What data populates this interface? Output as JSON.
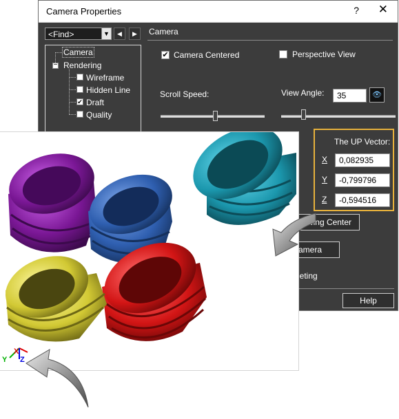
{
  "window": {
    "title": "Camera Properties",
    "help_glyph": "?",
    "close_glyph": "✕"
  },
  "find": {
    "value": "<Find>"
  },
  "tree": {
    "items": [
      {
        "label": "Camera"
      },
      {
        "label": "Rendering"
      },
      {
        "label": "Wireframe",
        "checked": false
      },
      {
        "label": "Hidden Line",
        "checked": false
      },
      {
        "label": "Draft",
        "checked": true
      },
      {
        "label": "Quality",
        "checked": false
      }
    ]
  },
  "camera": {
    "section_title": "Camera",
    "camera_centered": {
      "label": "Camera Centered",
      "checked": true
    },
    "perspective_view": {
      "label": "Perspective View",
      "checked": false
    },
    "scroll_speed_label": "Scroll Speed:",
    "scroll_speed_value": 0.52,
    "view_angle_label": "View Angle:",
    "view_angle_value": "35",
    "view_angle_slider": 0.19
  },
  "up_vector": {
    "title": "The UP Vector:",
    "x_label": "X",
    "x_value": "0,082935",
    "y_label": "Y",
    "y_value": "-0,799796",
    "z_label": "Z",
    "z_value": "-0,594516"
  },
  "buttons": {
    "drawing_center": "awing Center",
    "camera": "amera",
    "help": "Help"
  },
  "partial_text": {
    "leting": "leting"
  },
  "image": {
    "objects": [
      "purple-fitting",
      "blue-fitting",
      "teal-fitting",
      "yellow-fitting",
      "red-fitting"
    ],
    "axis_labels": {
      "y": "Y",
      "x": "X",
      "z": "Z"
    }
  },
  "colors": {
    "dialog_bg": "#3c3c3c",
    "highlight": "#e8b23c",
    "purple": "#8a1fa8",
    "blue": "#2f5fb0",
    "teal": "#1b97ad",
    "yellow": "#d9d13a",
    "red": "#d21515"
  }
}
